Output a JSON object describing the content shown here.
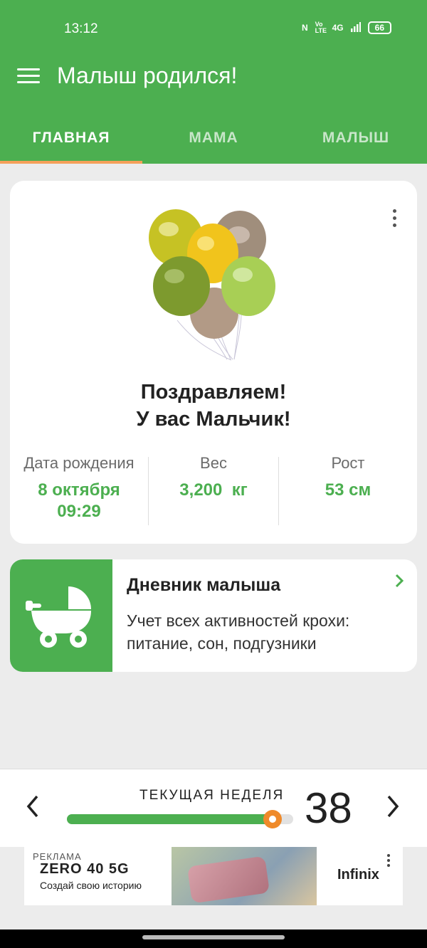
{
  "status_bar": {
    "time": "13:12",
    "nfc": "N",
    "volte": "Vo LTE",
    "network": "4G",
    "battery": "66"
  },
  "app_bar": {
    "title": "Малыш родился!"
  },
  "tabs": [
    {
      "label": "ГЛАВНАЯ",
      "active": true
    },
    {
      "label": "МАМА",
      "active": false
    },
    {
      "label": "МАЛЫШ",
      "active": false
    }
  ],
  "congrats_card": {
    "line1": "Поздравляем!",
    "line2": "У вас Мальчик!",
    "stats": [
      {
        "label": "Дата рождения",
        "value_line1": "8 октября",
        "value_line2": "09:29"
      },
      {
        "label": "Вес",
        "value_line1": "3,200  кг"
      },
      {
        "label": "Рост",
        "value_line1": "53 см"
      }
    ]
  },
  "diary_card": {
    "title": "Дневник малыша",
    "description": "Учет всех активностей крохи: питание, сон, подгузники"
  },
  "current_week": {
    "label": "ТЕКУЩАЯ НЕДЕЛЯ",
    "number": "38",
    "progress": 0.91
  },
  "ad": {
    "label": "РЕКЛАМА",
    "product": "ZERO 40 5G",
    "tagline": "Создай свою историю",
    "brand": "Infinix"
  },
  "colors": {
    "primary": "#4caf50",
    "accent": "#ef8a2a",
    "tab_indicator": "#f5a05a"
  }
}
